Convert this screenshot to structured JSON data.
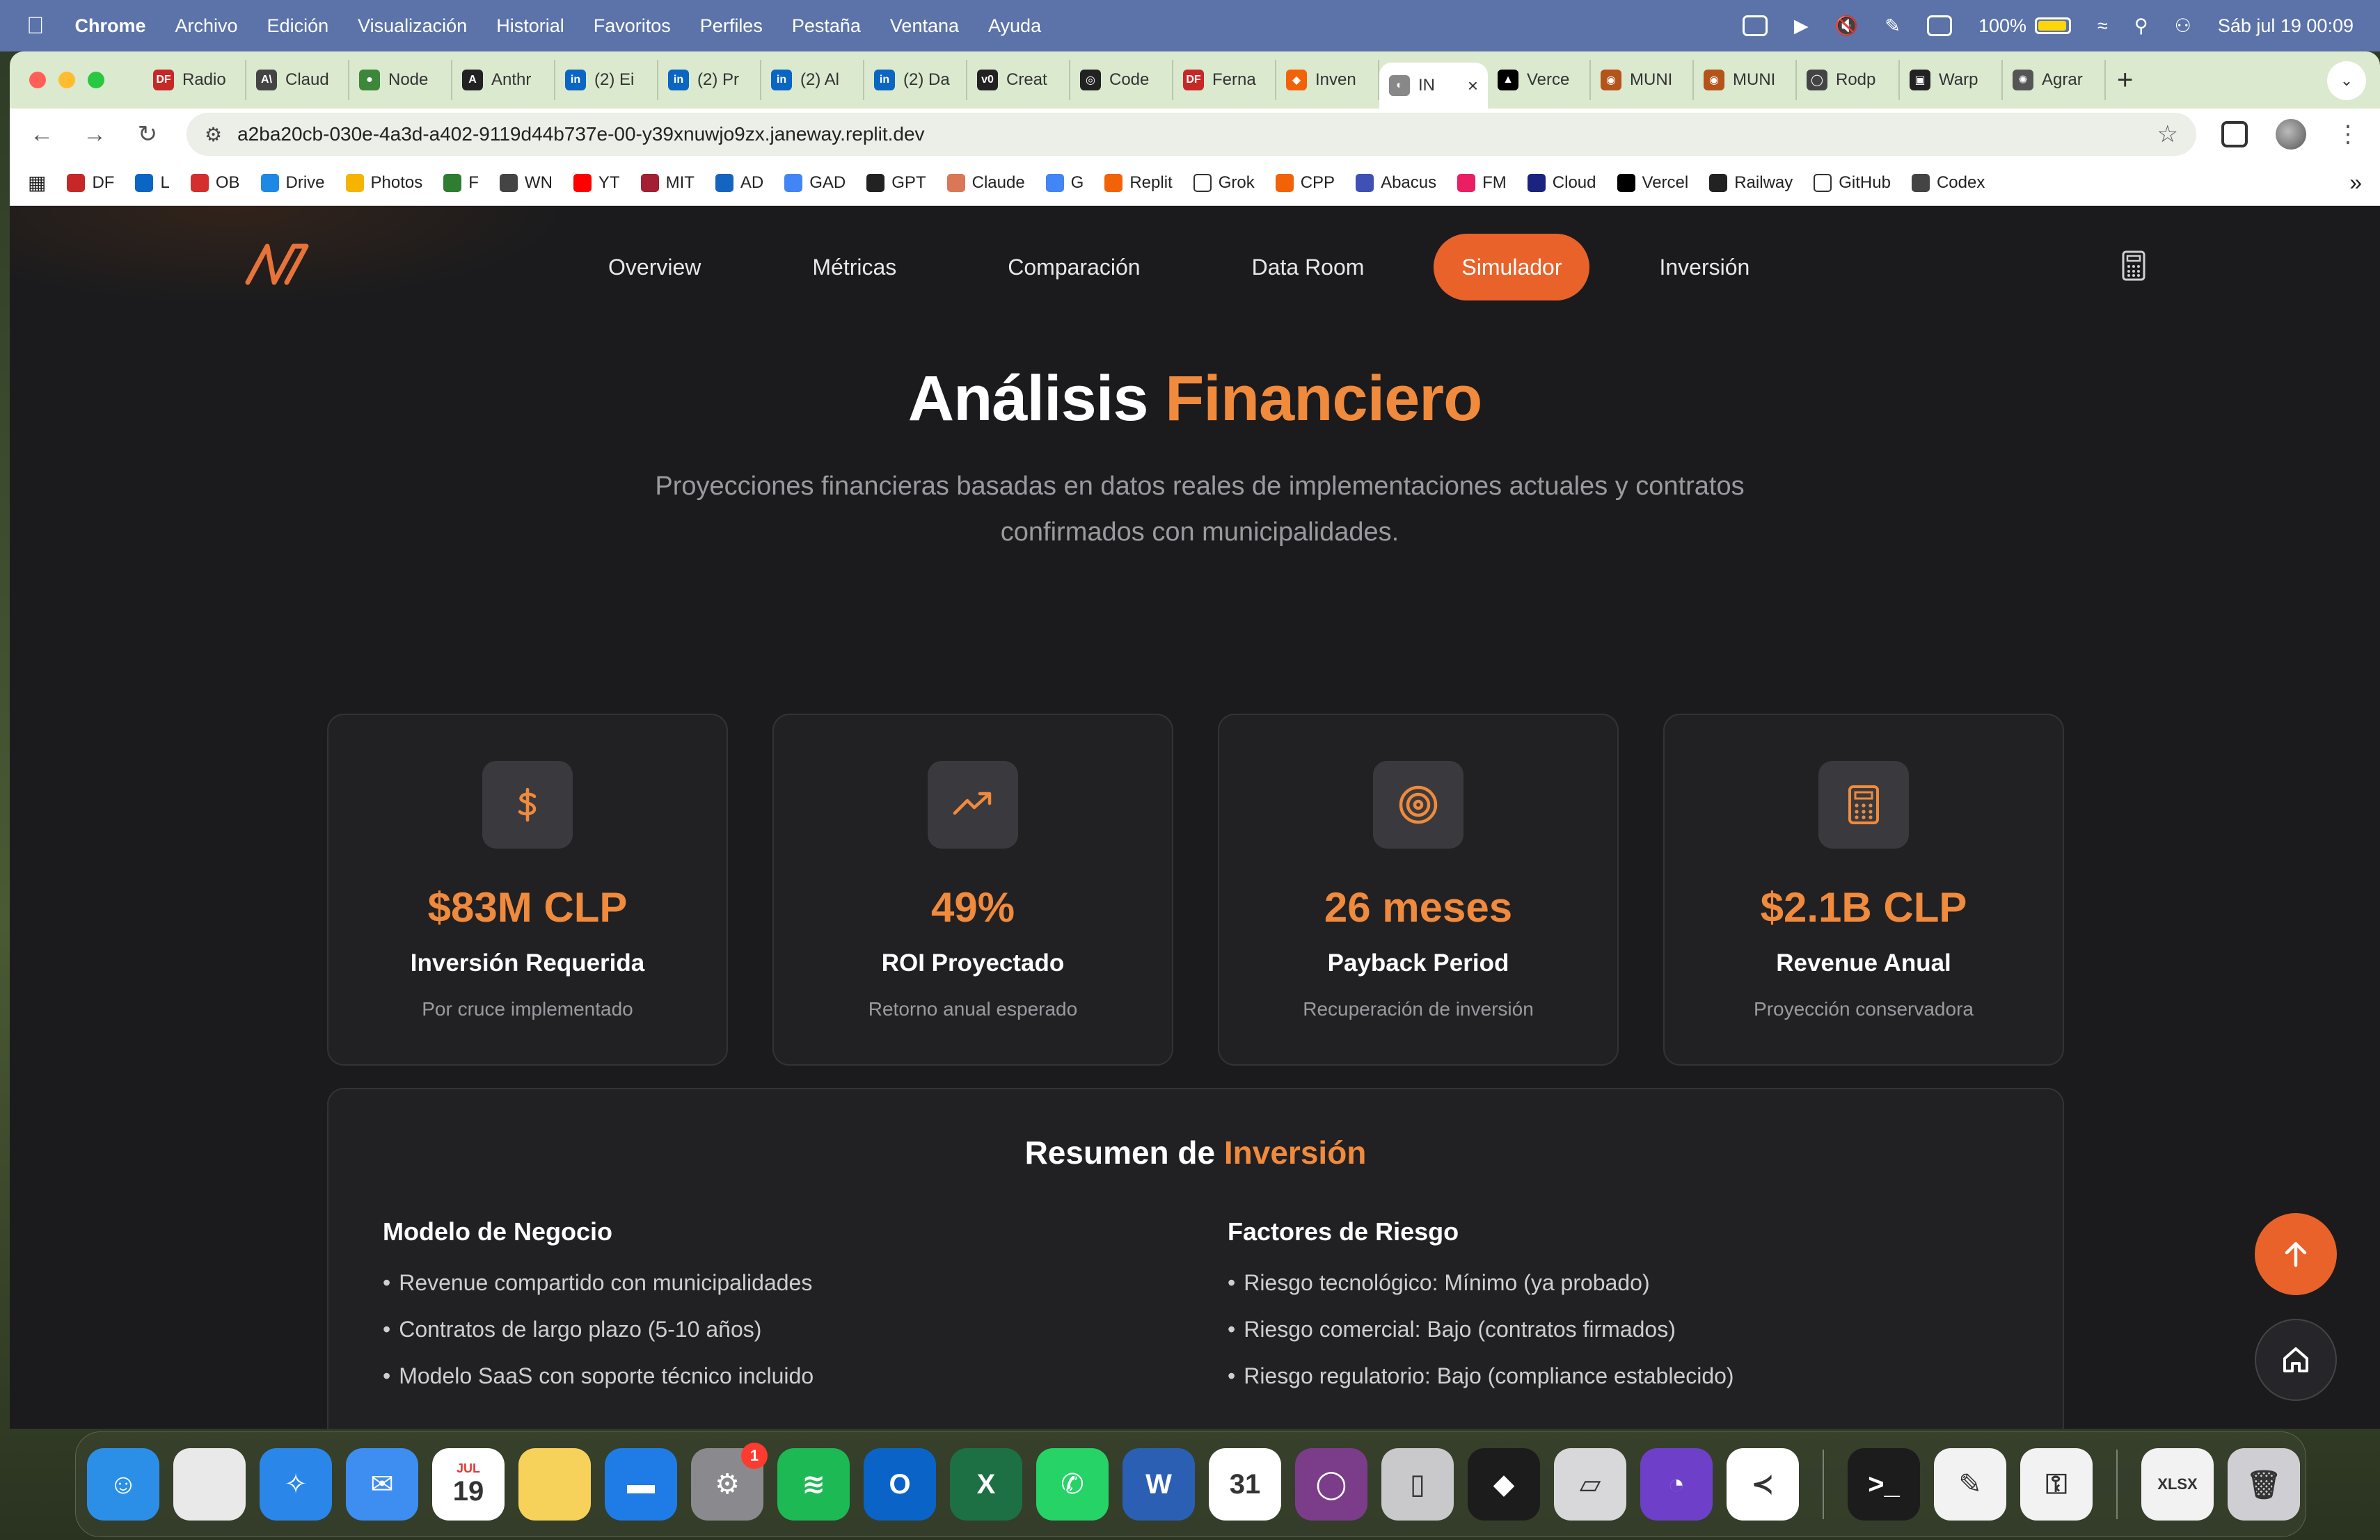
{
  "menubar": {
    "app_name": "Chrome",
    "items": [
      "Archivo",
      "Edición",
      "Visualización",
      "Historial",
      "Favoritos",
      "Perfiles",
      "Pestaña",
      "Ventana",
      "Ayuda"
    ],
    "battery": "100%",
    "datetime": "Sáb jul 19  00:09"
  },
  "tabs": [
    {
      "label": "Radio",
      "color": "#c62828",
      "glyph": "DF"
    },
    {
      "label": "Claud",
      "color": "#444444",
      "glyph": "A\\"
    },
    {
      "label": "Node",
      "color": "#3c873a",
      "glyph": "●"
    },
    {
      "label": "Anthr",
      "color": "#222222",
      "glyph": "A"
    },
    {
      "label": "(2) Ei",
      "color": "#0a66c2",
      "glyph": "in"
    },
    {
      "label": "(2) Pr",
      "color": "#0a66c2",
      "glyph": "in"
    },
    {
      "label": "(2) Al",
      "color": "#0a66c2",
      "glyph": "in"
    },
    {
      "label": "(2) Da",
      "color": "#0a66c2",
      "glyph": "in"
    },
    {
      "label": "Creat",
      "color": "#222222",
      "glyph": "v0"
    },
    {
      "label": "Code",
      "color": "#222222",
      "glyph": "◎"
    },
    {
      "label": "Ferna",
      "color": "#c62828",
      "glyph": "DF"
    },
    {
      "label": "Inven",
      "color": "#f26207",
      "glyph": "◆"
    },
    {
      "label": "IN",
      "color": "#888888",
      "glyph": "◐",
      "active": true
    },
    {
      "label": "Verce",
      "color": "#000000",
      "glyph": "▲"
    },
    {
      "label": "MUNI",
      "color": "#b4531a",
      "glyph": "◉"
    },
    {
      "label": "MUNI",
      "color": "#b4531a",
      "glyph": "◉"
    },
    {
      "label": "Rodp",
      "color": "#444444",
      "glyph": "◯"
    },
    {
      "label": "Warp",
      "color": "#222222",
      "glyph": "▣"
    },
    {
      "label": "Agrar",
      "color": "#555555",
      "glyph": "✺"
    }
  ],
  "tab_close": "×",
  "new_tab": "+",
  "url": "a2ba20cb-030e-4a3d-a402-9119d44b737e-00-y39xnuwjo9zx.janeway.replit.dev",
  "bookmarks": [
    {
      "label": "DF",
      "color": "#c62828"
    },
    {
      "label": "L",
      "color": "#0a66c2"
    },
    {
      "label": "OB",
      "color": "#d32f2f"
    },
    {
      "label": "Drive",
      "color": "#1e88e5"
    },
    {
      "label": "Photos",
      "color": "#f4b400"
    },
    {
      "label": "F",
      "color": "#2e7d32"
    },
    {
      "label": "WN",
      "color": "#444444"
    },
    {
      "label": "YT",
      "color": "#ff0000"
    },
    {
      "label": "MIT",
      "color": "#a31f34"
    },
    {
      "label": "AD",
      "color": "#1565c0"
    },
    {
      "label": "GAD",
      "color": "#4285f4"
    },
    {
      "label": "GPT",
      "color": "#222222"
    },
    {
      "label": "Claude",
      "color": "#d97757"
    },
    {
      "label": "G",
      "color": "#4285f4"
    },
    {
      "label": "Replit",
      "color": "#f26207"
    },
    {
      "label": "Grok",
      "color": "#ffffff"
    },
    {
      "label": "CPP",
      "color": "#f26207"
    },
    {
      "label": "Abacus",
      "color": "#3f51b5"
    },
    {
      "label": "FM",
      "color": "#e91e63"
    },
    {
      "label": "Cloud",
      "color": "#1a237e"
    },
    {
      "label": "Vercel",
      "color": "#000000"
    },
    {
      "label": "Railway",
      "color": "#222222"
    },
    {
      "label": "GitHub",
      "color": "#ffffff"
    },
    {
      "label": "Codex",
      "color": "#444444"
    }
  ],
  "site": {
    "nav": [
      "Overview",
      "Métricas",
      "Comparación",
      "Data Room",
      "Simulador",
      "Inversión"
    ],
    "nav_active_index": 4,
    "accent": "#e8622a",
    "title_main": "Análisis",
    "title_accent": "Financiero",
    "subtitle": "Proyecciones financieras basadas en datos reales de implementaciones actuales y contratos confirmados con municipalidades.",
    "cards": [
      {
        "icon": "dollar-icon",
        "value": "$83M CLP",
        "label": "Inversión Requerida",
        "sub": "Por cruce implementado"
      },
      {
        "icon": "trending-up-icon",
        "value": "49%",
        "label": "ROI Proyectado",
        "sub": "Retorno anual esperado"
      },
      {
        "icon": "target-icon",
        "value": "26 meses",
        "label": "Payback Period",
        "sub": "Recuperación de inversión"
      },
      {
        "icon": "calculator-icon",
        "value": "$2.1B CLP",
        "label": "Revenue Anual",
        "sub": "Proyección conservadora"
      }
    ],
    "summary": {
      "title_main": "Resumen de",
      "title_accent": "Inversión",
      "left": {
        "heading": "Modelo de Negocio",
        "items": [
          "Revenue compartido con municipalidades",
          "Contratos de largo plazo (5-10 años)",
          "Modelo SaaS con soporte técnico incluido"
        ]
      },
      "right": {
        "heading": "Factores de Riesgo",
        "items": [
          "Riesgo tecnológico: Mínimo (ya probado)",
          "Riesgo comercial: Bajo (contratos firmados)",
          "Riesgo regulatorio: Bajo (compliance establecido)"
        ]
      }
    }
  },
  "dock": {
    "apps": [
      {
        "name": "finder",
        "color": "#2b8fe8",
        "glyph": "☺"
      },
      {
        "name": "chrome",
        "color": "#e9e9e9",
        "glyph": ""
      },
      {
        "name": "safari",
        "color": "#2a86e8",
        "glyph": "✧"
      },
      {
        "name": "mail",
        "color": "#3d8ef0",
        "glyph": "✉"
      },
      {
        "name": "calendar",
        "color": "#ffffff",
        "glyph": "19",
        "extra": "JUL"
      },
      {
        "name": "notes",
        "color": "#f7d25a",
        "glyph": ""
      },
      {
        "name": "keynote",
        "color": "#1f7ce6",
        "glyph": "▬"
      },
      {
        "name": "system-settings",
        "color": "#8a8a8e",
        "glyph": "⚙",
        "badge": "1"
      },
      {
        "name": "spotify",
        "color": "#1db954",
        "glyph": "≋"
      },
      {
        "name": "outlook",
        "color": "#0a64c8",
        "glyph": "O"
      },
      {
        "name": "excel",
        "color": "#1d7044",
        "glyph": "X"
      },
      {
        "name": "whatsapp",
        "color": "#25d366",
        "glyph": "✆"
      },
      {
        "name": "word",
        "color": "#2b5fb3",
        "glyph": "W"
      },
      {
        "name": "fantastical",
        "color": "#ffffff",
        "glyph": "31"
      },
      {
        "name": "circle-app",
        "color": "#7b3d8a",
        "glyph": "◯"
      },
      {
        "name": "iphone-mirroring",
        "color": "#c9c9cc",
        "glyph": "▯"
      },
      {
        "name": "replit",
        "color": "#1c1c1c",
        "glyph": "◆"
      },
      {
        "name": "parallels",
        "color": "#d8d8da",
        "glyph": "▱"
      },
      {
        "name": "github-desktop",
        "color": "#6e40c9",
        "glyph": "◔"
      },
      {
        "name": "vscode",
        "color": "#ffffff",
        "glyph": "≺"
      },
      {
        "name": "terminal",
        "color": "#1c1c1c",
        "glyph": ">_"
      },
      {
        "name": "textedit",
        "color": "#f2f2f2",
        "glyph": "✎"
      },
      {
        "name": "passwords",
        "color": "#f2f2f2",
        "glyph": "⚿"
      },
      {
        "name": "xlsx-file",
        "color": "#f2f2f2",
        "glyph": "XLSX"
      },
      {
        "name": "trash",
        "color": "#cfcfd3",
        "glyph": "🗑"
      }
    ]
  }
}
